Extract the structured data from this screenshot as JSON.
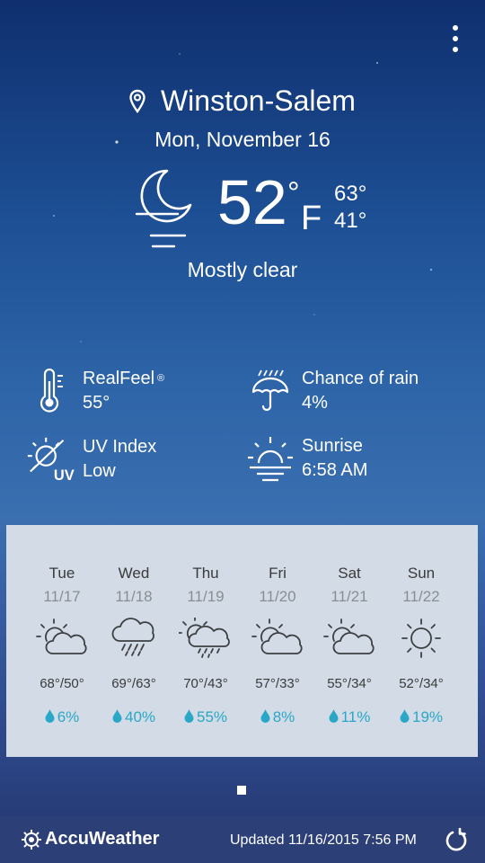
{
  "header": {
    "city": "Winston-Salem",
    "date": "Mon, November 16"
  },
  "current": {
    "temp": "52",
    "degree": "°",
    "unit": "F",
    "high": "63°",
    "low": "41°",
    "condition": "Mostly clear",
    "icon": "moon-mostly-clear-icon"
  },
  "details": [
    {
      "label": "RealFeel",
      "sup": "®",
      "value": "55°",
      "icon": "thermometer-icon"
    },
    {
      "label": "Chance of rain",
      "value": "4%",
      "icon": "umbrella-icon"
    },
    {
      "label": "UV Index",
      "value": "Low",
      "icon": "uv-index-icon"
    },
    {
      "label": "Sunrise",
      "value": "6:58 AM",
      "icon": "sunrise-icon"
    }
  ],
  "forecast": [
    {
      "day": "Tue",
      "date": "11/17",
      "hilo": "68°/50°",
      "rain": "6%",
      "icon": "partly-cloudy-icon"
    },
    {
      "day": "Wed",
      "date": "11/18",
      "hilo": "69°/63°",
      "rain": "40%",
      "icon": "rain-icon"
    },
    {
      "day": "Thu",
      "date": "11/19",
      "hilo": "70°/43°",
      "rain": "55%",
      "icon": "partly-sunny-rain-icon"
    },
    {
      "day": "Fri",
      "date": "11/20",
      "hilo": "57°/33°",
      "rain": "8%",
      "icon": "partly-cloudy-icon"
    },
    {
      "day": "Sat",
      "date": "11/21",
      "hilo": "55°/34°",
      "rain": "11%",
      "icon": "partly-cloudy-icon"
    },
    {
      "day": "Sun",
      "date": "11/22",
      "hilo": "52°/34°",
      "rain": "19%",
      "icon": "sunny-icon"
    }
  ],
  "footer": {
    "brand": "AccuWeather",
    "updated": "Updated 11/16/2015 7:56 PM"
  },
  "colors": {
    "forecast_bg": "#d3dce6",
    "rain_text": "#29a7c6",
    "footer_bg": "#2d3f77"
  }
}
